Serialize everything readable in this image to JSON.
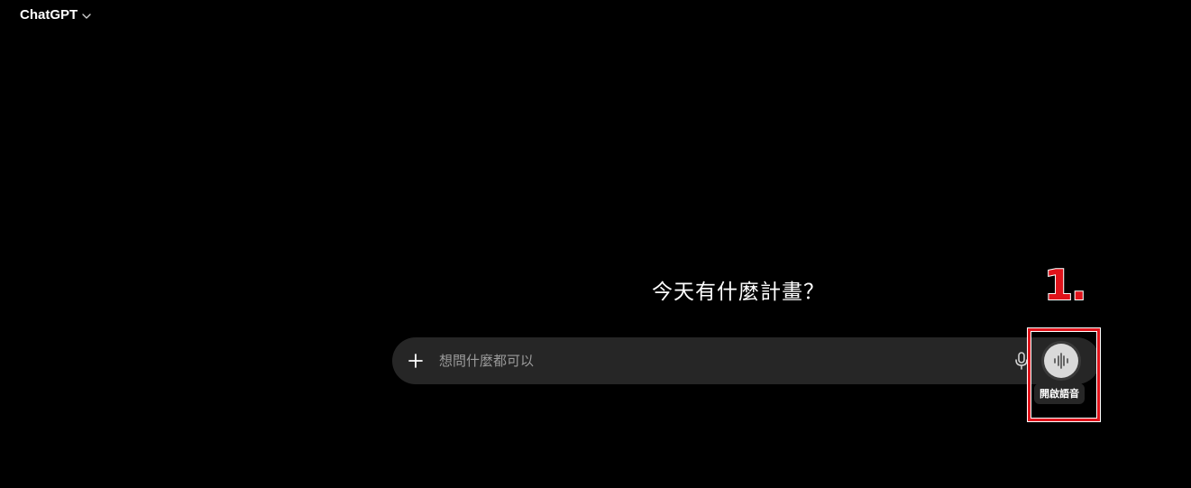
{
  "header": {
    "model_name": "ChatGPT",
    "chevron_icon": "chevron-down-icon"
  },
  "main": {
    "headline": "今天有什麼計畫？"
  },
  "composer": {
    "plus_icon": "plus-icon",
    "placeholder": "想問什麼都可以",
    "value": "",
    "mic_icon": "microphone-icon",
    "voice_icon": "voice-waveform-icon",
    "voice_tooltip": "開啟語音"
  },
  "annotation": {
    "step_label": "1.",
    "highlight_color": "#e0131b"
  },
  "colors": {
    "background": "#000000",
    "composer_bg": "#262626",
    "voice_button_bg": "#d9d9d9"
  }
}
